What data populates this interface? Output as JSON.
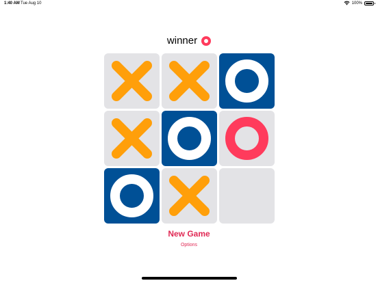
{
  "status_bar": {
    "time": "1:40 AM",
    "date": "Tue Aug 10",
    "battery": "100%",
    "battery_level": 1.0
  },
  "header": {
    "winner_label": "winner",
    "winner_mark": "O",
    "winner_color": "#ff3b5c"
  },
  "colors": {
    "x_mark": "#ff9f0a",
    "o_tile": "#005096",
    "o_win": "#ff3b5c",
    "empty_tile": "#e3e3e6"
  },
  "board": {
    "cells": [
      {
        "mark": "X",
        "win": false
      },
      {
        "mark": "X",
        "win": false
      },
      {
        "mark": "O",
        "win": false
      },
      {
        "mark": "X",
        "win": false
      },
      {
        "mark": "O",
        "win": false
      },
      {
        "mark": "O",
        "win": true
      },
      {
        "mark": "O",
        "win": false
      },
      {
        "mark": "X",
        "win": false
      },
      {
        "mark": "",
        "win": false
      }
    ]
  },
  "actions": {
    "new_game": "New Game",
    "options": "Options"
  }
}
